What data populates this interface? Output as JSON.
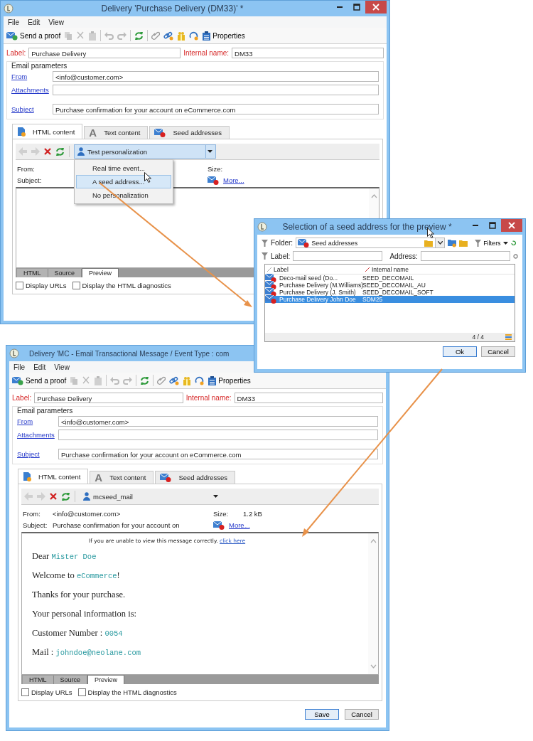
{
  "windows": [
    {
      "title": "Delivery 'Purchase Delivery (DM33)' *",
      "window_controls": true,
      "menu": [
        "File",
        "Edit",
        "View"
      ],
      "toolbar": {
        "send_proof": "Send a proof",
        "properties": "Properties"
      },
      "label": {
        "caption": "Label:",
        "value": "Purchase Delivery"
      },
      "internal_name": {
        "caption": "Internal name:",
        "value": "DM33"
      },
      "email_parameters": {
        "legend": "Email parameters",
        "from": {
          "caption": "From",
          "value": "<info@customer.com>"
        },
        "attachments": {
          "caption": "Attachments"
        },
        "subject": {
          "caption": "Subject",
          "value": "Purchase confirmation for your account on eCommerce.com"
        }
      },
      "content_tabs": [
        {
          "label": "HTML content",
          "kind": "html",
          "selected": true
        },
        {
          "label": "Text content",
          "kind": "text",
          "icon": "A",
          "selected": false
        },
        {
          "label": "Seed addresses",
          "kind": "seed",
          "selected": false
        }
      ],
      "personalization": {
        "value": "Test personalization",
        "open": true,
        "options": [
          {
            "label": "Real time event...",
            "selected": false
          },
          {
            "label": "A seed address...",
            "selected": true
          },
          {
            "label": "No personalization",
            "selected": false
          }
        ]
      },
      "preview_header": {
        "from_label": "From:",
        "subject_label": "Subject:",
        "size_label": "Size:",
        "more_link": "More..."
      },
      "view_tabs": [
        {
          "label": "HTML",
          "selected": false
        },
        {
          "label": "Source",
          "selected": false
        },
        {
          "label": "Preview",
          "selected": true
        }
      ],
      "options": [
        {
          "label": "Display URLs",
          "checked": false
        },
        {
          "label": "Display the HTML diagnostics",
          "checked": false
        }
      ]
    },
    {
      "title": "Delivery 'MC - Email Transactional Message  /  Event Type : com",
      "menu": [
        "File",
        "Edit",
        "View"
      ],
      "toolbar": {
        "send_proof": "Send a proof",
        "properties": "Properties"
      },
      "label": {
        "caption": "Label:",
        "value": "Purchase Delivery"
      },
      "internal_name": {
        "caption": "Internal name:",
        "value": "DM33"
      },
      "email_parameters": {
        "legend": "Email parameters",
        "from": {
          "caption": "From",
          "value": "<info@customer.com>"
        },
        "attachments": {
          "caption": "Attachments"
        },
        "subject": {
          "caption": "Subject",
          "value": "Purchase confirmation for your account on eCommerce.com"
        }
      },
      "content_tabs": [
        {
          "label": "HTML content",
          "kind": "html",
          "selected": true
        },
        {
          "label": "Text content",
          "kind": "text",
          "icon": "A",
          "selected": false
        },
        {
          "label": "Seed addresses",
          "kind": "seed",
          "selected": false
        }
      ],
      "personalization": {
        "value": "mcseed_mail",
        "open": false
      },
      "preview_header": {
        "from_label": "From:",
        "from_value": "<info@customer.com>",
        "subject_label": "Subject:",
        "subject_value": "Purchase confirmation for your account on",
        "size_label": "Size:",
        "size_value": "1.2 kB",
        "more_link": "More..."
      },
      "message": {
        "notice": "If you are unable to view this message correctly.",
        "notice_link": "click here",
        "lines": [
          [
            {
              "text": "Dear "
            },
            {
              "text": "Mister Doe",
              "kind": "field"
            }
          ],
          [
            {
              "text": "Welcome to "
            },
            {
              "text": "eCommerce",
              "kind": "field"
            },
            {
              "text": "!"
            }
          ],
          [
            {
              "text": "Thanks for your purchase."
            }
          ],
          [
            {
              "text": "Your personal information is:"
            }
          ],
          [
            {
              "text": "Customer Number : "
            },
            {
              "text": "0054",
              "kind": "field"
            }
          ],
          [
            {
              "text": "Mail : "
            },
            {
              "text": "johndoe@neolane.com",
              "kind": "field"
            }
          ]
        ]
      },
      "view_tabs": [
        {
          "label": "HTML",
          "selected": false
        },
        {
          "label": "Source",
          "selected": false
        },
        {
          "label": "Preview",
          "selected": true
        }
      ],
      "options": [
        {
          "label": "Display URLs",
          "checked": false
        },
        {
          "label": "Display the HTML diagnostics",
          "checked": false
        }
      ],
      "buttons": [
        {
          "label": "Save",
          "default": true
        },
        {
          "label": "Cancel",
          "default": false
        }
      ]
    }
  ],
  "dialog": {
    "title": "Selection of a seed address for the preview *",
    "window_controls": true,
    "folder": {
      "caption": "Folder:",
      "value": "Seed addresses"
    },
    "filters": "Filters",
    "label_filter": {
      "caption": "Label:"
    },
    "address_filter": {
      "caption": "Address:"
    },
    "columns": [
      "Label",
      "Internal name"
    ],
    "rows": [
      {
        "label": "Deco-mail seed (Do...",
        "internal_name": "SEED_DECOMAIL",
        "selected": false
      },
      {
        "label": "Purchase Delivery (M.Williams)",
        "internal_name": "SEED_DECOMAIL_AU",
        "selected": false
      },
      {
        "label": "Purchase Delivery (J. Smith)",
        "internal_name": "SEED_DECOMAIL_SOFT",
        "selected": false
      },
      {
        "label": "Purchase Delivery John Doe",
        "internal_name": "SDM25",
        "selected": true
      }
    ],
    "count": "4 / 4",
    "buttons": [
      {
        "label": "Ok",
        "default": true
      },
      {
        "label": "Cancel",
        "default": false
      }
    ]
  }
}
